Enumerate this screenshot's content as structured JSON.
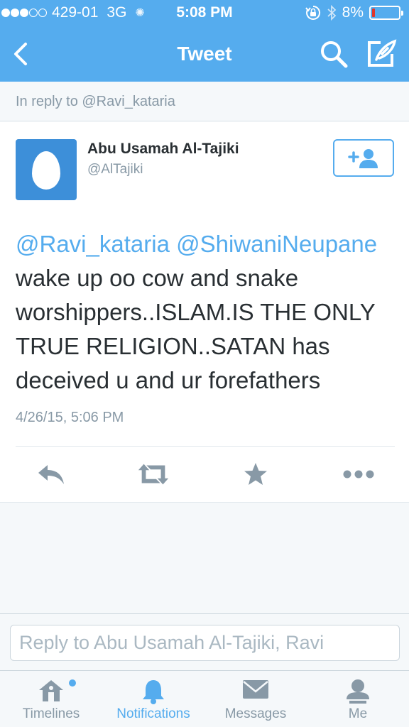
{
  "status_bar": {
    "carrier": "429-01",
    "network": "3G",
    "time": "5:08 PM",
    "battery": "8%",
    "signal_dots_full": 3,
    "battery_level": 0.08
  },
  "nav": {
    "title": "Tweet",
    "icons": [
      "back-chevron-icon",
      "search-icon",
      "compose-icon"
    ]
  },
  "reply_context": "In reply to @Ravi_kataria",
  "tweet": {
    "author_name": "Abu Usamah Al-Tajiki",
    "author_handle": "@AlTajiki",
    "mention_1": "@Ravi_kataria",
    "mention_2": "@ShiwaniNeupane",
    "body": "wake up oo cow and snake worshippers..ISLAM.IS THE ONLY TRUE RELIGION..SATAN has deceived u and ur forefathers",
    "timestamp": "4/26/15, 5:06 PM",
    "actions": [
      "reply-icon",
      "retweet-icon",
      "favorite-icon",
      "more-icon"
    ]
  },
  "composer": {
    "placeholder": "Reply to Abu Usamah Al-Tajiki, Ravi"
  },
  "tabs": [
    {
      "label": "Timelines",
      "icon": "home-icon",
      "active": false
    },
    {
      "label": "Notifications",
      "icon": "bell-icon",
      "active": true
    },
    {
      "label": "Messages",
      "icon": "envelope-icon",
      "active": false
    },
    {
      "label": "Me",
      "icon": "person-icon",
      "active": false
    }
  ],
  "colors": {
    "brand": "#55acee",
    "avatar": "#3d8fd9",
    "battery_low": "#e0352b",
    "muted": "#8899a6",
    "icon_gray": "#8899a6"
  }
}
